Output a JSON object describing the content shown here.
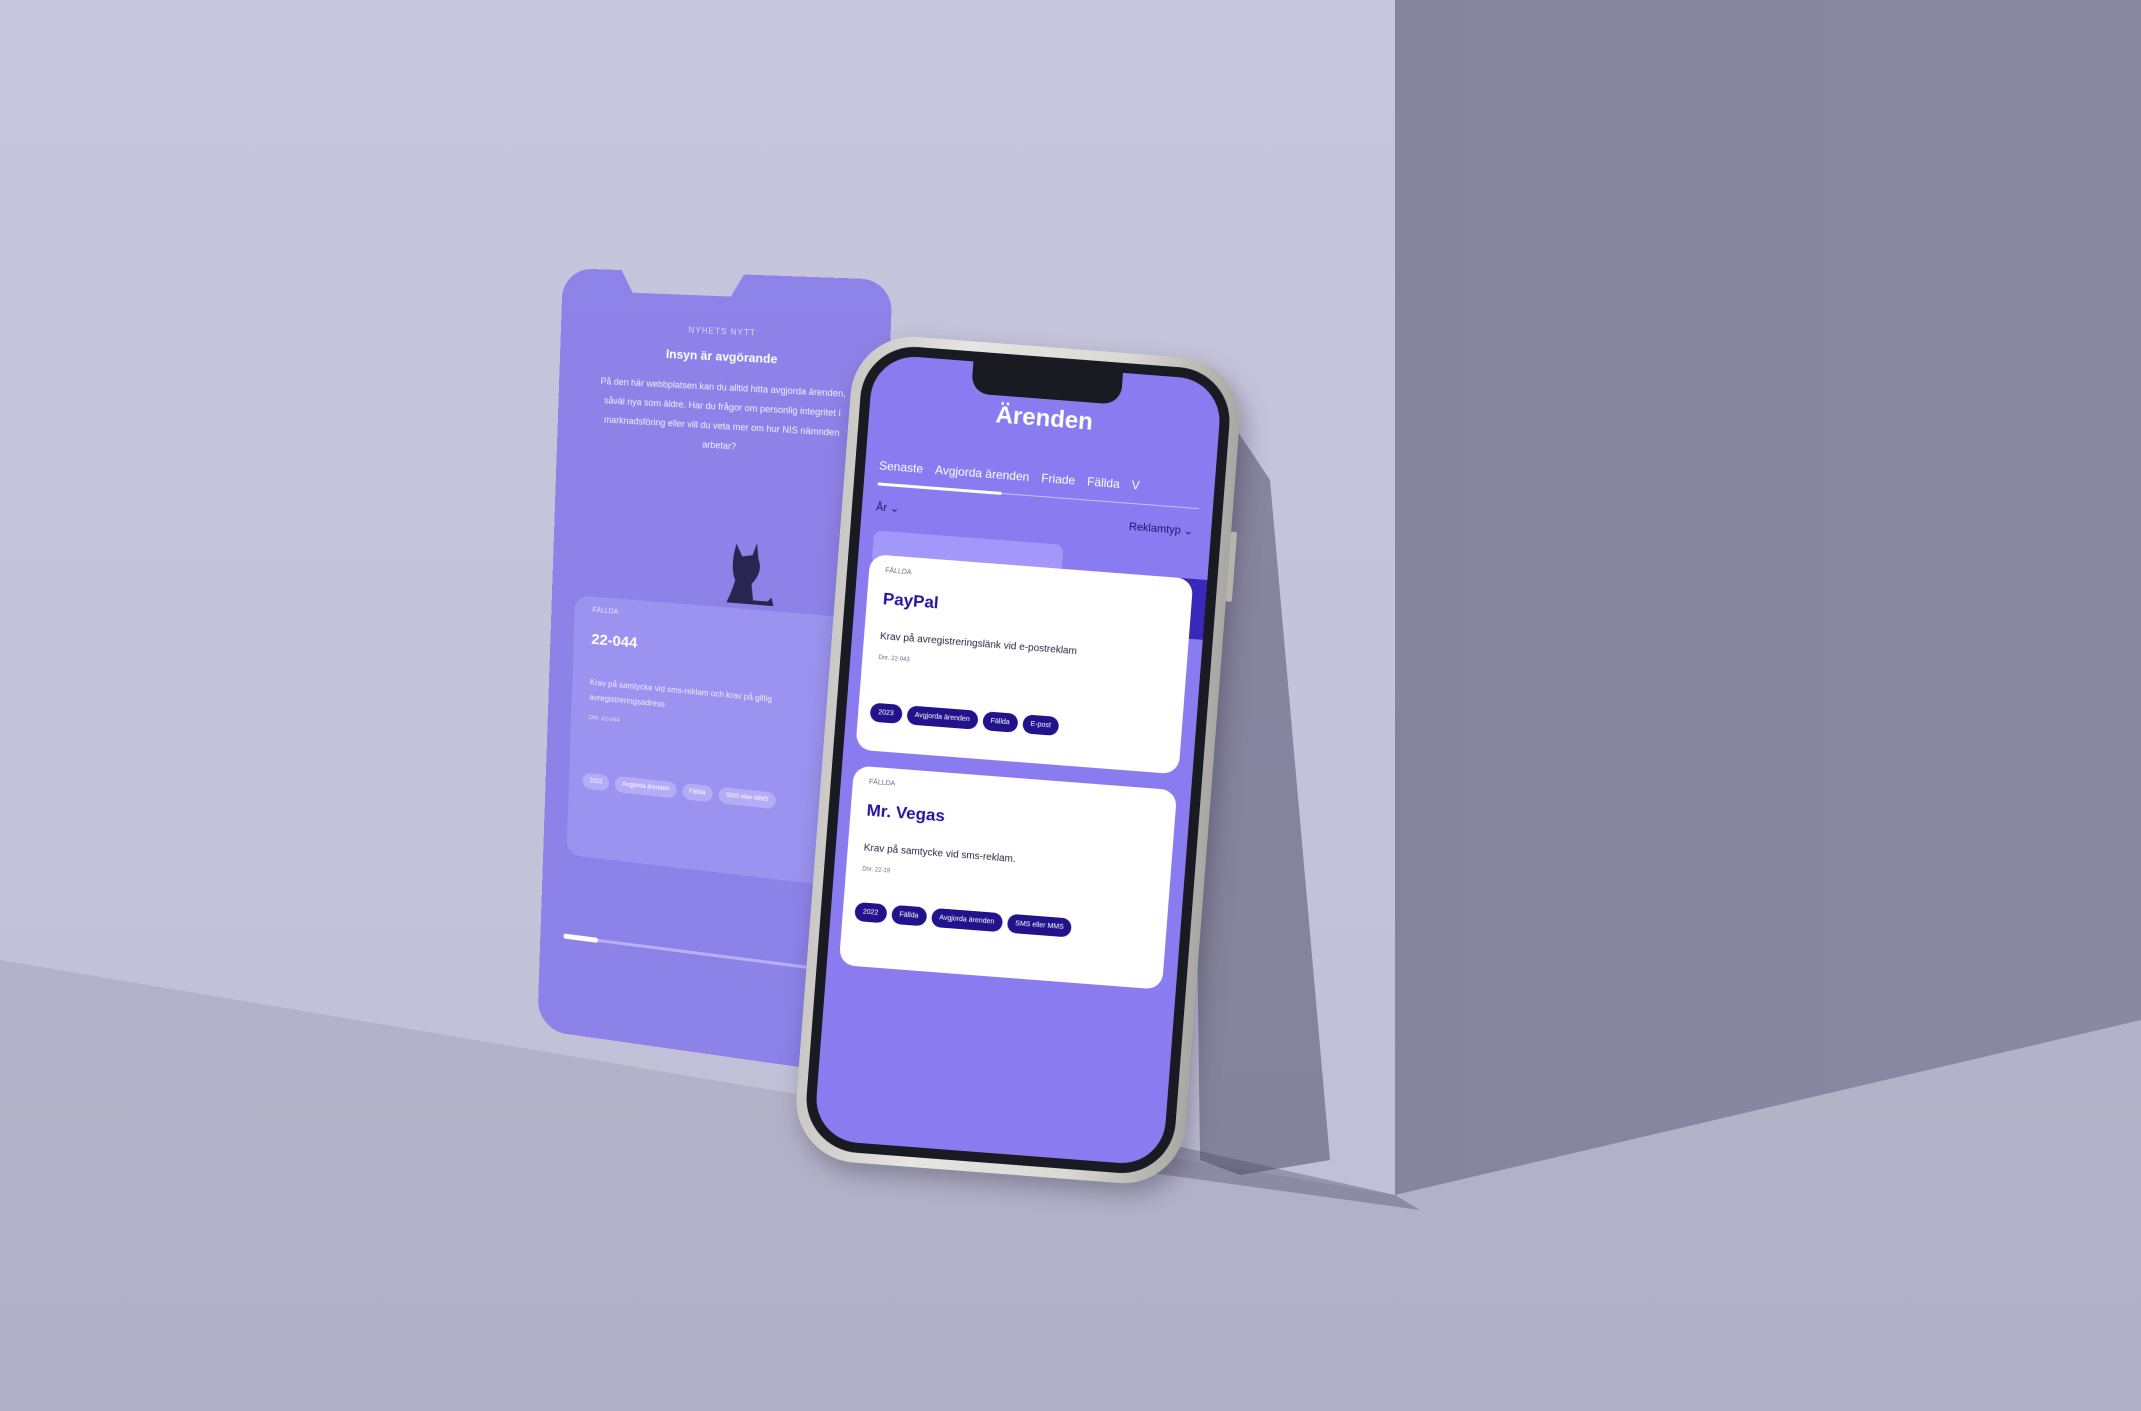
{
  "ghost_screen": {
    "kicker": "NYHETS NYTT",
    "heading": "Insyn är avgörande",
    "body": "På den här webbplatsen kan du alltid hitta avgjorda ärenden, såväl nya som äldre. Har du frågor om personlig integritet i marknadsföring eller vill du veta mer om hur NIS nämnden arbetar?",
    "card": {
      "label": "FÄLLDA",
      "number": "22-044",
      "description": "Krav på samtycke vid sms-reklam och krav på giltig avregistreringsadress",
      "dnr": "Dnr. 22-044",
      "tags": [
        "2022",
        "Avgjorda ärenden",
        "Fällda",
        "SMS eller MMS"
      ]
    },
    "progress": 0.13
  },
  "phone": {
    "title": "Ärenden",
    "tabs": [
      "Senaste",
      "Avgjorda ärenden",
      "Friade",
      "Fällda",
      "V"
    ],
    "active_tab": "Senaste",
    "filter_year": "År",
    "filter_type": "Reklamtyp",
    "cases": [
      {
        "label": "FÄLLDA",
        "name": "PayPal",
        "description": "Krav på avregistreringslänk vid e-postreklam",
        "dnr": "Dnr. 22-043",
        "tags": [
          "2023",
          "Avgjorda ärenden",
          "Fällda",
          "E-post"
        ]
      },
      {
        "label": "FÄLLDA",
        "name": "Mr. Vegas",
        "description": "Krav på samtycke vid sms-reklam.",
        "dnr": "Dnr. 22-19",
        "tags": [
          "2022",
          "Fällda",
          "Avgjorda ärenden",
          "SMS eller MMS"
        ]
      }
    ]
  },
  "colors": {
    "wall": "#c8c6dd",
    "block": "#83829a",
    "accent": "#8a7cf0",
    "chip": "#22138c",
    "ghost": "#7e70ec"
  }
}
